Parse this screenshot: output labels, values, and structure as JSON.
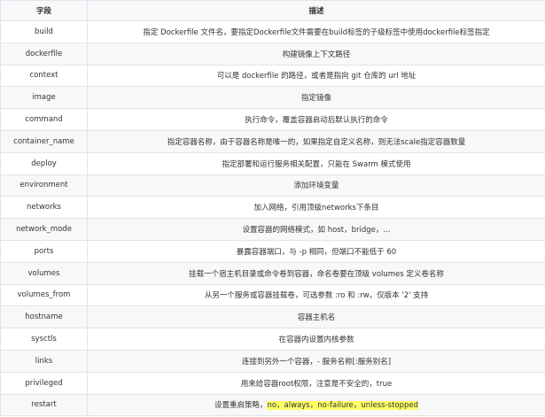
{
  "table": {
    "headers": [
      "字段",
      "描述"
    ],
    "rows": [
      {
        "field": "build",
        "desc": "指定 Dockerfile 文件名，要指定Dockerfile文件需要在build标签的子级标签中使用dockerfile标签指定"
      },
      {
        "field": "dockerfile",
        "desc": "构建镜像上下文路径"
      },
      {
        "field": "context",
        "desc": "可以是 dockerfile 的路径，或者是指向 git 仓库的 url 地址"
      },
      {
        "field": "image",
        "desc": "指定镜像"
      },
      {
        "field": "command",
        "desc": "执行命令，覆盖容器启动后默认执行的命令"
      },
      {
        "field": "container_name",
        "desc": "指定容器名称，由于容器名称是唯一的，如果指定自定义名称，则无法scale指定容器数量"
      },
      {
        "field": "deploy",
        "desc": "指定部署和运行服务相关配置，只能在 Swarm 模式使用"
      },
      {
        "field": "environment",
        "desc": "添加环境变量"
      },
      {
        "field": "networks",
        "desc": "加入网络，引用顶级networks下条目"
      },
      {
        "field": "network_mode",
        "desc": "设置容器的网络模式，如 host，bridge，..."
      },
      {
        "field": "ports",
        "desc": "暴露容器端口，与 -p 相同，但端口不能低于 60"
      },
      {
        "field": "volumes",
        "desc": "挂载一个宿主机目录或命令卷到容器，命名卷要在顶级 volumes 定义卷名称"
      },
      {
        "field": "volumes_from",
        "desc": "从另一个服务或容器挂载卷，可选参数 :ro 和 :rw，仅版本 '2' 支持"
      },
      {
        "field": "hostname",
        "desc": "容器主机名"
      },
      {
        "field": "sysctls",
        "desc": "在容器内设置内核参数"
      },
      {
        "field": "links",
        "desc": "连接到另外一个容器，- 服务名称[:服务别名]"
      },
      {
        "field": "privileged",
        "desc": "用来给容器root权限，注意是不安全的，true"
      },
      {
        "field": "restart",
        "desc_prefix": "设置重启策略，",
        "desc_highlight": "no，always，no-failure，unless-stopped"
      }
    ]
  },
  "colors": {
    "highlight": "#ffff66",
    "header_bg": "#f6f8fa",
    "border": "#e1e4e8"
  }
}
